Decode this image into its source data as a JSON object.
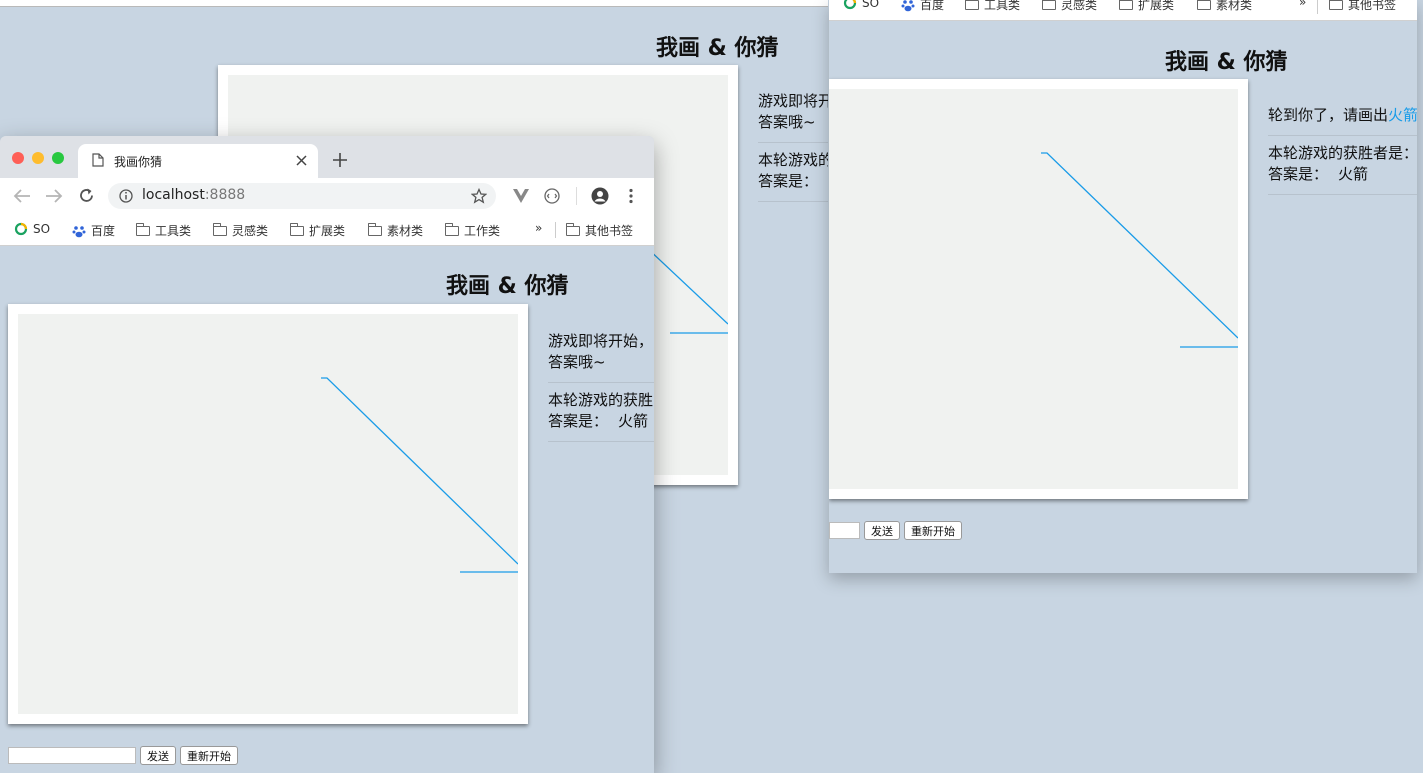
{
  "game": {
    "title": "我画 & 你猜",
    "stroke_color": "#1a9ce8",
    "answer_highlight_color": "#1a9ce8"
  },
  "browser": {
    "tab_title": "我画你猜",
    "url_host": "localhost",
    "url_port": ":8888",
    "bookmarks": [
      {
        "label": "SO",
        "icon": "so-icon"
      },
      {
        "label": "百度",
        "icon": "baidu-paw-icon"
      },
      {
        "label": "工具类",
        "icon": "folder-icon"
      },
      {
        "label": "灵感类",
        "icon": "folder-icon"
      },
      {
        "label": "扩展类",
        "icon": "folder-icon"
      },
      {
        "label": "素材类",
        "icon": "folder-icon"
      },
      {
        "label": "工作类",
        "icon": "folder-icon"
      }
    ],
    "more_bookmarks": "»",
    "other_bookmarks": "其他书签"
  },
  "front_window": {
    "messages": [
      {
        "line1": "游戏即将开始，",
        "line2": "答案哦~"
      },
      {
        "line1": "本轮游戏的获胜",
        "line2": "答案是：",
        "answer": "火箭"
      }
    ],
    "input_value": "",
    "send_label": "发送",
    "restart_label": "重新开始"
  },
  "back_window": {
    "messages": [
      {
        "line1": "游戏即将开",
        "line2": "答案哦~"
      },
      {
        "line1": "本轮游戏的",
        "line2": "答案是："
      }
    ]
  },
  "right_window": {
    "bookmarks": [
      {
        "label": "SO",
        "icon": "so-icon"
      },
      {
        "label": "百度",
        "icon": "baidu-paw-icon"
      },
      {
        "label": "工具类",
        "icon": "folder-icon"
      },
      {
        "label": "灵感类",
        "icon": "folder-icon"
      },
      {
        "label": "扩展类",
        "icon": "folder-icon"
      },
      {
        "label": "素材类",
        "icon": "folder-icon"
      }
    ],
    "more_bookmarks": "»",
    "other_bookmarks": "其他书签",
    "messages": [
      {
        "prefix": "轮到你了，请画出",
        "highlight": "火箭"
      },
      {
        "line1": "本轮游戏的获胜者是：",
        "line2": "答案是：",
        "answer": "火箭"
      }
    ],
    "input_value": "",
    "send_label": "发送",
    "restart_label": "重新开始"
  }
}
